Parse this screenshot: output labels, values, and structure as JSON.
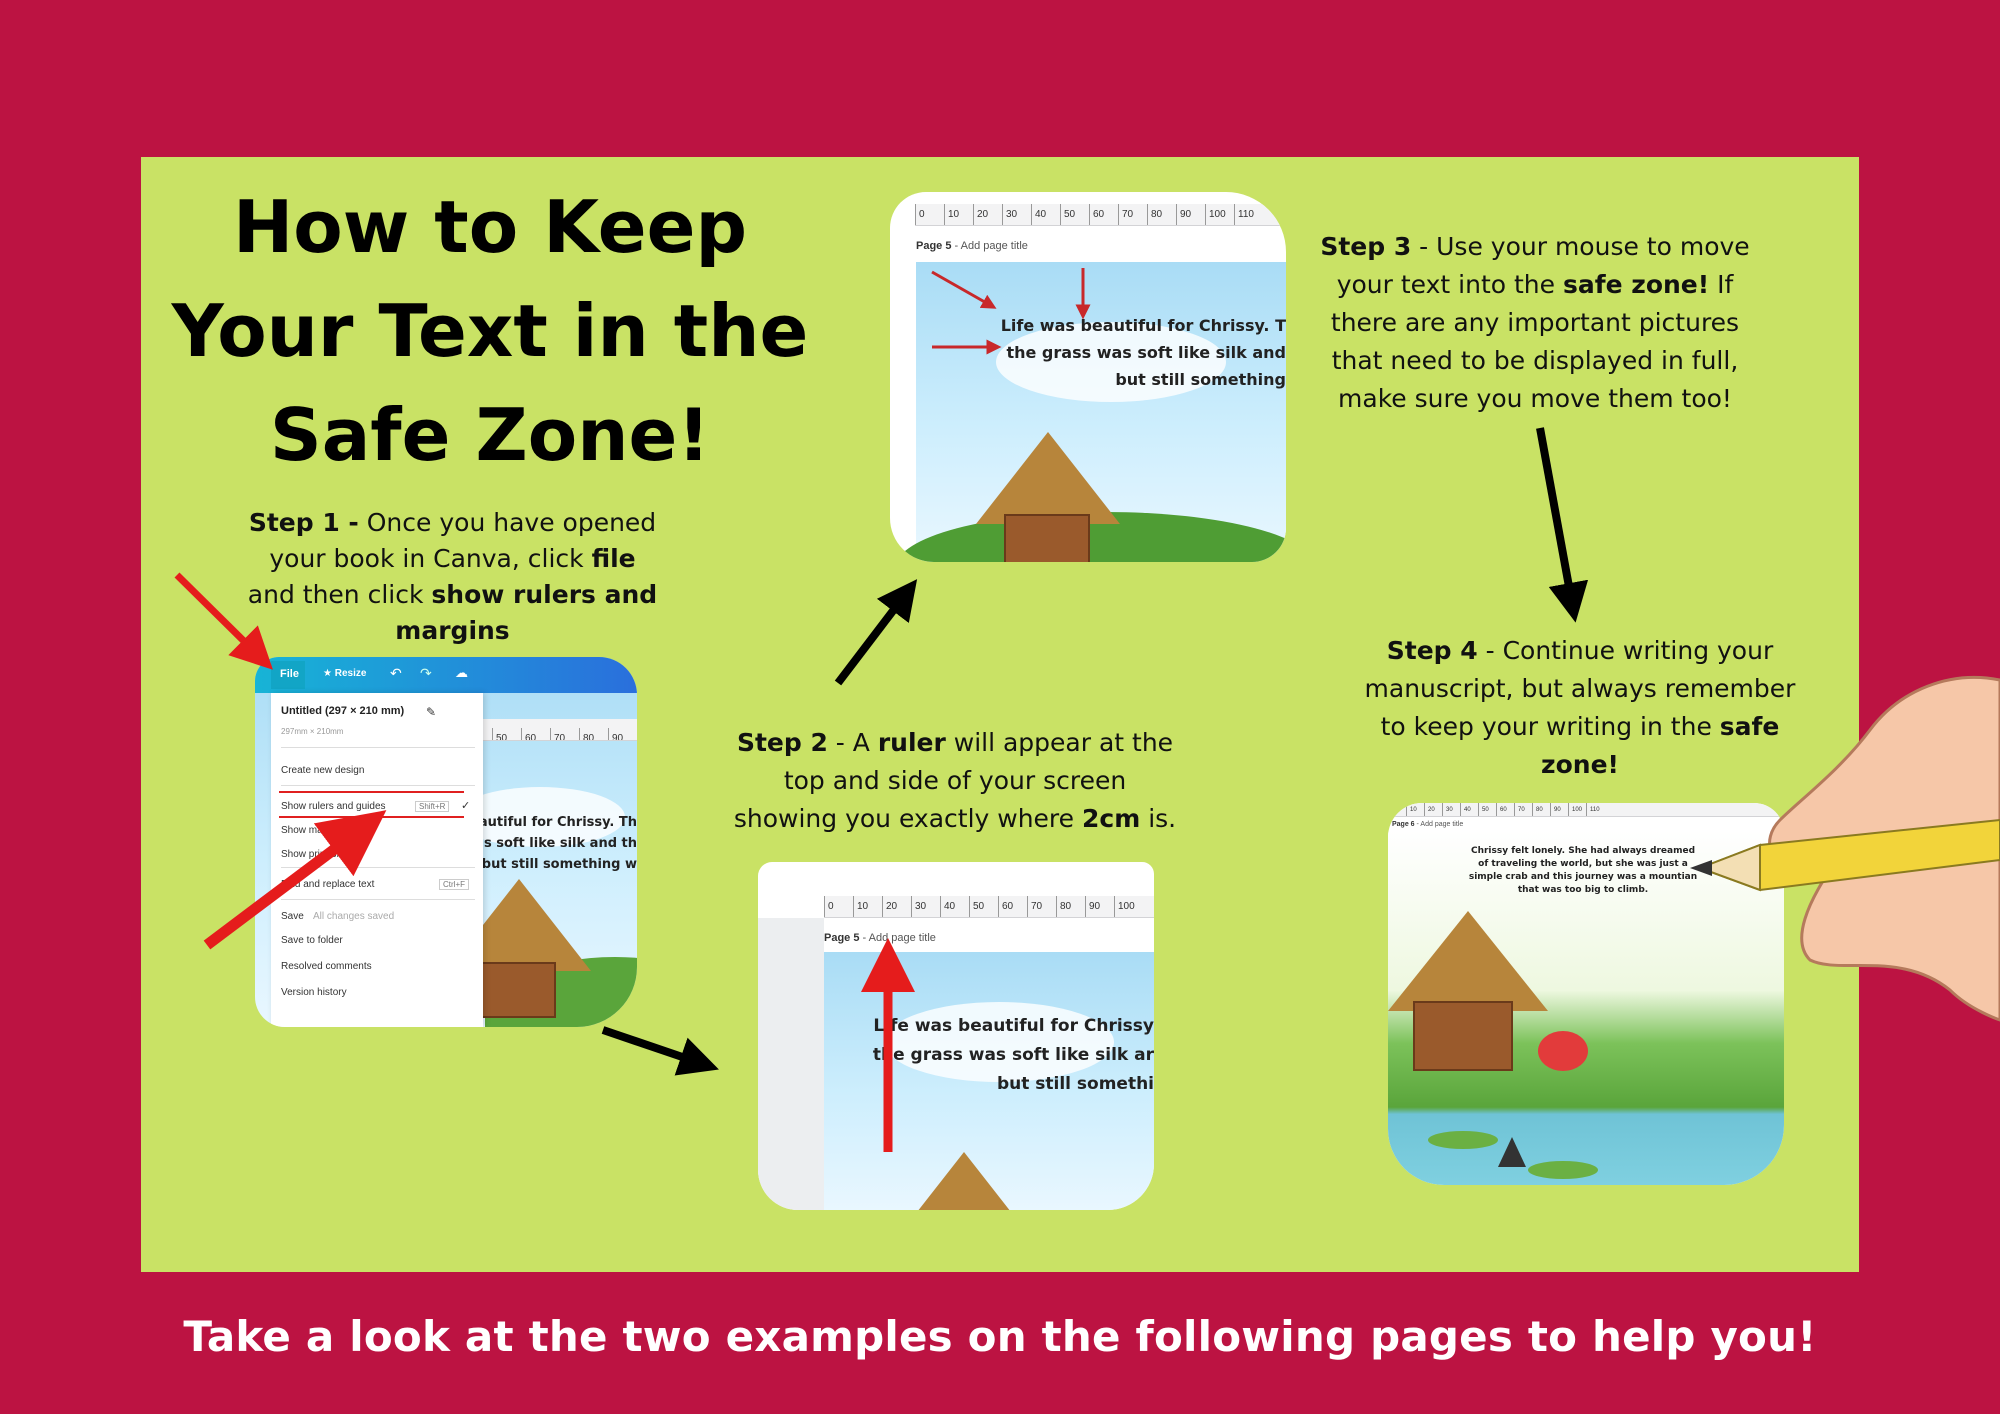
{
  "title": {
    "line1": "How to Keep",
    "line2": "Your Text in the",
    "line3": "Safe Zone!"
  },
  "step1": {
    "bold": "Step 1 -",
    "text1": " Once you have opened your book in Canva, click ",
    "b2": "file",
    "text2": " and then click ",
    "b3": "show rulers and margins"
  },
  "step2": {
    "bold": "Step 2",
    "text1": " -  A ",
    "b2": "ruler",
    "text2": " will appear at the top and side of your screen showing you exactly where ",
    "b3": "2cm",
    "text3": " is."
  },
  "step3": {
    "bold": "Step 3",
    "text1": " - Use your mouse to move your text into the ",
    "b2": "safe zone!",
    "text2": " If there are any important pictures that need to be displayed in full, make sure you move them too!"
  },
  "step4": {
    "bold": "Step 4",
    "text1": " - Continue writing your manuscript, but always remember to keep your writing in the ",
    "b2": "safe zone!"
  },
  "footer": "Take a look at the two examples on the following pages to help you!",
  "canva_menu": {
    "file_tab": "File",
    "resize_tab": "Resize",
    "doc_title": "Untitled (297 × 210 mm)",
    "doc_size": "297mm × 210mm",
    "create_new": "Create new design",
    "show_rulers": "Show rulers and guides",
    "show_rulers_shortcut": "Shift+R",
    "show_margins": "Show margins",
    "show_print_bleed": "Show print bleed",
    "find_replace": "Find and replace text",
    "find_replace_shortcut": "Ctrl+F",
    "save": "Save",
    "save_status": "All changes saved",
    "save_folder": "Save to folder",
    "resolved": "Resolved comments",
    "version": "Version history"
  },
  "page_label": {
    "page": "Page 5",
    "placeholder": "- Add page title"
  },
  "page6_label": {
    "page": "Page 6",
    "placeholder": "- Add page title"
  },
  "ruler_ticks": [
    "0",
    "10",
    "20",
    "30",
    "40",
    "50",
    "60",
    "70",
    "80",
    "90",
    "100",
    "110"
  ],
  "story_text": {
    "line1": "Life was beautiful for Chrissy. T",
    "line2": "the grass was soft like silk and",
    "line3": "but still something",
    "s1_line1": "s beautiful for Chrissy. Th",
    "s1_line2": "s was soft like silk and th",
    "s1_line3": "but still something w",
    "s2_line1": "Life was beautiful for Chrissy",
    "s2_line2": "the grass was soft like silk ar",
    "s2_line3": "but still somethi"
  },
  "step4_story": "Chrissy felt lonely. She had always dreamed of traveling the world, but she was just a simple crab and this journey was a mountian that was too big to climb.",
  "colors": {
    "background": "#bc1342",
    "panel": "#c9e265",
    "canva_blue": "#1a9fd9",
    "arrow_red": "#e51c1c"
  }
}
